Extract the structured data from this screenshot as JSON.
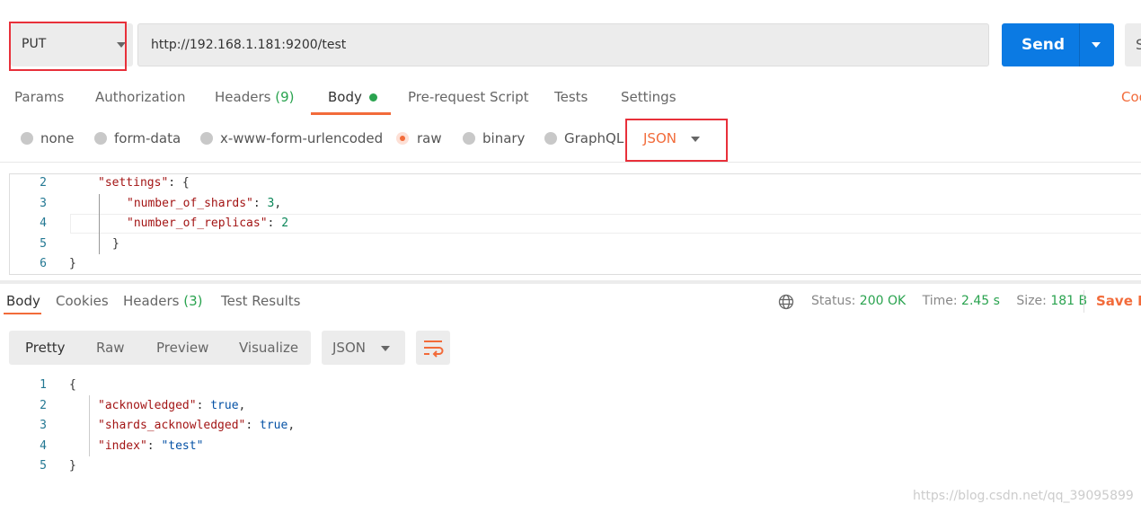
{
  "request": {
    "method": "PUT",
    "url": "http://192.168.1.181:9200/test",
    "send_label": "Send",
    "save_label_partial": "S"
  },
  "request_tabs": [
    {
      "label": "Params"
    },
    {
      "label": "Authorization"
    },
    {
      "label": "Headers",
      "count": "(9)"
    },
    {
      "label": "Body",
      "active": true
    },
    {
      "label": "Pre-request Script"
    },
    {
      "label": "Tests"
    },
    {
      "label": "Settings"
    }
  ],
  "cookies_link_partial": "Coo",
  "body_types": [
    {
      "label": "none"
    },
    {
      "label": "form-data"
    },
    {
      "label": "x-www-form-urlencoded"
    },
    {
      "label": "raw",
      "selected": true
    },
    {
      "label": "binary"
    },
    {
      "label": "GraphQL"
    }
  ],
  "raw_format": "JSON",
  "request_body_lines": [
    {
      "n": "2",
      "k": "\"settings\"",
      "rest": ": {"
    },
    {
      "n": "3",
      "k": "\"number_of_shards\"",
      "rest": ": ",
      "v": "3",
      "tail": ","
    },
    {
      "n": "4",
      "k": "\"number_of_replicas\"",
      "rest": ": ",
      "v": "2"
    },
    {
      "n": "5",
      "plain": "}"
    },
    {
      "n": "6",
      "plain": "}"
    }
  ],
  "response_tabs": [
    {
      "label": "Body",
      "active": true
    },
    {
      "label": "Cookies"
    },
    {
      "label": "Headers",
      "count": "(3)"
    },
    {
      "label": "Test Results"
    }
  ],
  "status": {
    "status_label": "Status:",
    "status": "200 OK",
    "time_label": "Time:",
    "time": "2.45 s",
    "size_label": "Size:",
    "size": "181 B",
    "save_response_partial": "Save Re"
  },
  "view_modes": [
    "Pretty",
    "Raw",
    "Preview",
    "Visualize"
  ],
  "response_format": "JSON",
  "response_lines": [
    {
      "n": "1",
      "plain": "{"
    },
    {
      "n": "2",
      "k": "\"acknowledged\"",
      "rest": ": ",
      "v": "true",
      "tail": ","
    },
    {
      "n": "3",
      "k": "\"shards_acknowledged\"",
      "rest": ": ",
      "v": "true",
      "tail": ","
    },
    {
      "n": "4",
      "k": "\"index\"",
      "rest": ": ",
      "v": "\"test\""
    },
    {
      "n": "5",
      "plain": "}"
    }
  ],
  "watermark": "https://blog.csdn.net/qq_39095899",
  "colors": {
    "accent": "#f26b3a",
    "send": "#0b7ae3",
    "success": "#2aa34f",
    "highlight_box": "#e8303a"
  }
}
